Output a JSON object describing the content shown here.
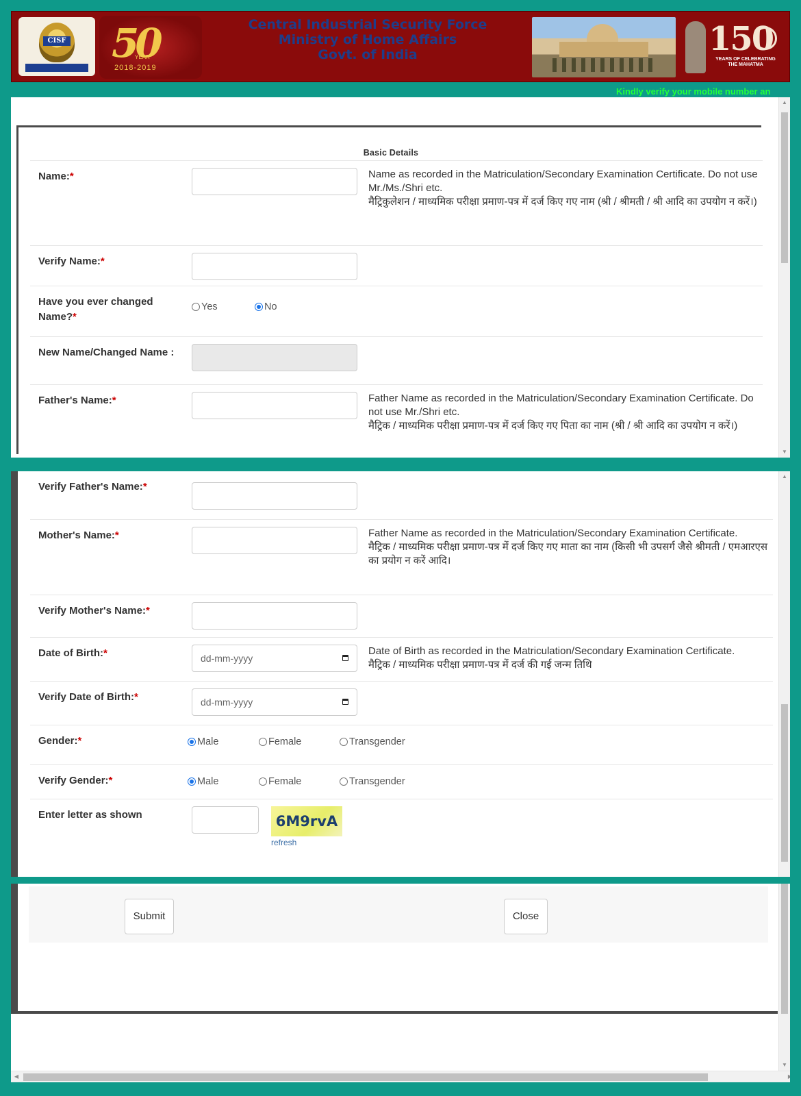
{
  "header": {
    "emblem_label": "CISF",
    "jubilee_number": "50",
    "jubilee_year_label": "YEAR",
    "jubilee_years": "2018-2019",
    "title_line1": "Central Industrial Security Force",
    "title_line2": "Ministry of Home Affairs",
    "title_line3": "Govt. of India",
    "mahatma_number": "150",
    "mahatma_caption": "YEARS OF CELEBRATING THE MAHATMA"
  },
  "marquee_text": "Kindly verify your mobile number an",
  "form": {
    "section_title": "Basic Details",
    "required_mark": "*",
    "name_label": "Name:",
    "name_help_en": "Name as recorded in the Matriculation/Secondary Examination Certificate. Do not use Mr./Ms./Shri etc.",
    "name_help_hi": "मैट्रिकुलेशन / माध्यमिक परीक्षा प्रमाण-पत्र में दर्ज किए गए नाम (श्री / श्रीमती / श्री आदि का उपयोग न करें।)",
    "verify_name_label": "Verify Name:",
    "changed_name_label": "Have you ever changed Name?",
    "changed_yes": "Yes",
    "changed_no": "No",
    "new_name_label": "New Name/Changed Name :",
    "father_label": "Father's Name:",
    "father_help_en": "Father Name as recorded in the Matriculation/Secondary Examination Certificate. Do not use Mr./Shri etc.",
    "father_help_hi": "मैट्रिक / माध्यमिक परीक्षा प्रमाण-पत्र में दर्ज किए गए पिता का नाम (श्री / श्री आदि का उपयोग न करें।)",
    "verify_father_label": "Verify Father's Name:",
    "mother_label": "Mother's Name:",
    "mother_help_en": "Father Name as recorded in the Matriculation/Secondary Examination Certificate.",
    "mother_help_hi": "मैट्रिक / माध्यमिक परीक्षा प्रमाण-पत्र में दर्ज किए गए माता का नाम (किसी भी उपसर्ग जैसे श्रीमती / एमआरएस का प्रयोग न करें आदि।",
    "verify_mother_label": "Verify Mother's Name:",
    "dob_label": "Date of Birth:",
    "dob_placeholder": "dd-mm-yyyy",
    "dob_help_en": "Date of Birth as recorded in the Matriculation/Secondary Examination Certificate.",
    "dob_help_hi": "मैट्रिक / माध्यमिक परीक्षा प्रमाण-पत्र में दर्ज की गई जन्म तिथि",
    "verify_dob_label": "Verify Date of Birth:",
    "gender_label": "Gender:",
    "verify_gender_label": "Verify Gender:",
    "gender_male": "Male",
    "gender_female": "Female",
    "gender_trans": "Transgender",
    "captcha_label": "Enter letter as shown",
    "captcha_text": "6M9rvA",
    "captcha_refresh": "refresh"
  },
  "buttons": {
    "submit": "Submit",
    "close": "Close"
  }
}
